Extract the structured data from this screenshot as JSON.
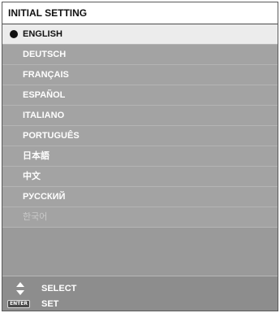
{
  "window": {
    "title": "INITIAL SETTING"
  },
  "languages": [
    {
      "label": "ENGLISH",
      "selected": true,
      "enabled": true
    },
    {
      "label": "DEUTSCH",
      "selected": false,
      "enabled": true
    },
    {
      "label": "FRANÇAIS",
      "selected": false,
      "enabled": true
    },
    {
      "label": "ESPAÑOL",
      "selected": false,
      "enabled": true
    },
    {
      "label": "ITALIANO",
      "selected": false,
      "enabled": true
    },
    {
      "label": "PORTUGUÊS",
      "selected": false,
      "enabled": true
    },
    {
      "label": "日本語",
      "selected": false,
      "enabled": true
    },
    {
      "label": "中文",
      "selected": false,
      "enabled": true
    },
    {
      "label": "РУССКИЙ",
      "selected": false,
      "enabled": true
    },
    {
      "label": "한국어",
      "selected": false,
      "enabled": false
    }
  ],
  "footer": {
    "select_label": "SELECT",
    "select_icon": "up-down-arrows-icon",
    "set_label": "SET",
    "set_icon": "enter-key-icon",
    "enter_key_text": "ENTER"
  },
  "colors": {
    "selected_background": "#ececec",
    "item_background": "#a3a3a3",
    "disabled_text": "#c9c9c9"
  }
}
